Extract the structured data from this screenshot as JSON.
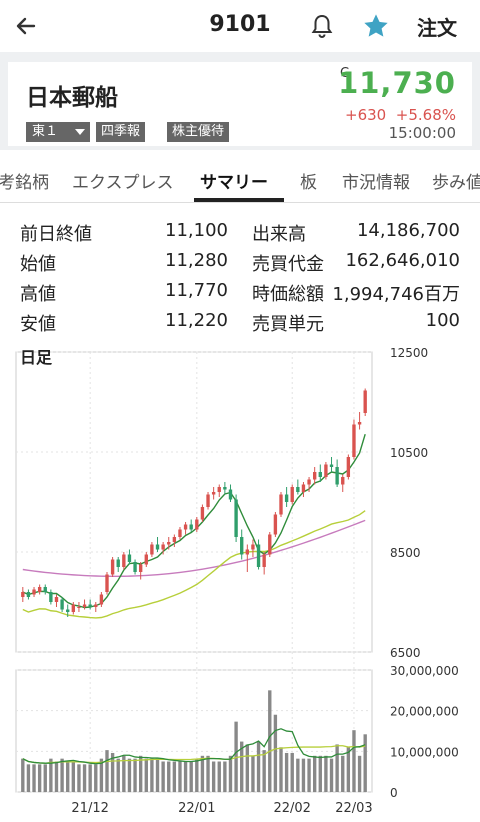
{
  "header": {
    "code": "9101",
    "order_label": "注文",
    "star_color": "#3fa3c4",
    "icons": [
      "back-arrow-icon",
      "bell-icon",
      "star-icon"
    ]
  },
  "stock": {
    "name": "日本郵船",
    "market": "東１",
    "tag_report": "四季報",
    "tag_yutai": "株主優待",
    "c_mark": "C",
    "price": "11,730",
    "change": "+630",
    "change_pct": "+5.68%",
    "time": "15:00:00",
    "price_color": "#4caf50",
    "change_color": "#d9534f"
  },
  "tabs": [
    "考銘柄",
    "エクスプレス",
    "サマリー",
    "板",
    "市況情報",
    "歩み値"
  ],
  "active_tab": "サマリー",
  "stats": {
    "prev_close_label": "前日終値",
    "prev_close": "11,100",
    "volume_label": "出来高",
    "volume": "14,186,700",
    "open_label": "始値",
    "open": "11,280",
    "trade_value_label": "売買代金",
    "trade_value": "162,646,010",
    "high_label": "高値",
    "high": "11,770",
    "market_cap_label": "時価総額",
    "market_cap": "1,994,746百万",
    "low_label": "安値",
    "low": "11,220",
    "unit_label": "売買単元",
    "unit": "100"
  },
  "chart_data": {
    "type": "candlestick",
    "title": "日足",
    "price_ticks": [
      "12500",
      "10500",
      "8500",
      "6500"
    ],
    "ylim": [
      6500,
      12500
    ],
    "volume_ticks": [
      "30,000,000",
      "20,000,000",
      "10,000,000",
      "0"
    ],
    "volume_ylim": [
      0,
      30000000
    ],
    "x_labels": [
      "21/12",
      "22/01",
      "22/02",
      "22/03"
    ],
    "candles_ohlc": [
      [
        7600,
        7800,
        7500,
        7700
      ],
      [
        7700,
        7750,
        7550,
        7600
      ],
      [
        7650,
        7800,
        7600,
        7750
      ],
      [
        7700,
        7850,
        7650,
        7800
      ],
      [
        7800,
        7850,
        7650,
        7700
      ],
      [
        7700,
        7750,
        7450,
        7500
      ],
      [
        7500,
        7650,
        7400,
        7600
      ],
      [
        7550,
        7600,
        7300,
        7350
      ],
      [
        7350,
        7450,
        7200,
        7300
      ],
      [
        7300,
        7500,
        7250,
        7450
      ],
      [
        7400,
        7500,
        7300,
        7400
      ],
      [
        7400,
        7550,
        7350,
        7450
      ],
      [
        7450,
        7550,
        7350,
        7400
      ],
      [
        7400,
        7500,
        7300,
        7450
      ],
      [
        7450,
        7700,
        7400,
        7650
      ],
      [
        7700,
        8100,
        7650,
        8050
      ],
      [
        8050,
        8400,
        8000,
        8350
      ],
      [
        8350,
        8400,
        8100,
        8200
      ],
      [
        8200,
        8500,
        8150,
        8450
      ],
      [
        8450,
        8550,
        8250,
        8300
      ],
      [
        8300,
        8350,
        8050,
        8100
      ],
      [
        8100,
        8300,
        7950,
        8250
      ],
      [
        8250,
        8500,
        8200,
        8450
      ],
      [
        8450,
        8700,
        8400,
        8650
      ],
      [
        8650,
        8800,
        8500,
        8550
      ],
      [
        8550,
        8700,
        8450,
        8650
      ],
      [
        8650,
        8800,
        8550,
        8700
      ],
      [
        8700,
        8850,
        8600,
        8800
      ],
      [
        8800,
        9000,
        8750,
        8950
      ],
      [
        8950,
        9100,
        8850,
        9050
      ],
      [
        9050,
        9150,
        8900,
        8950
      ],
      [
        8950,
        9200,
        8900,
        9150
      ],
      [
        9150,
        9450,
        9100,
        9400
      ],
      [
        9400,
        9700,
        9350,
        9650
      ],
      [
        9650,
        9800,
        9550,
        9700
      ],
      [
        9700,
        9850,
        9600,
        9800
      ],
      [
        9800,
        9900,
        9650,
        9750
      ],
      [
        9750,
        9850,
        9500,
        9550
      ],
      [
        9550,
        9650,
        8700,
        8800
      ],
      [
        8800,
        8950,
        8350,
        8450
      ],
      [
        8450,
        8650,
        8100,
        8550
      ],
      [
        8550,
        8750,
        8400,
        8650
      ],
      [
        8650,
        8750,
        8150,
        8200
      ],
      [
        8200,
        8500,
        8050,
        8450
      ],
      [
        8450,
        8900,
        8400,
        8850
      ],
      [
        8850,
        9300,
        8800,
        9250
      ],
      [
        9250,
        9700,
        9200,
        9650
      ],
      [
        9650,
        9800,
        9400,
        9500
      ],
      [
        9500,
        9850,
        9450,
        9800
      ],
      [
        9800,
        9950,
        9650,
        9700
      ],
      [
        9700,
        9900,
        9600,
        9850
      ],
      [
        9850,
        10000,
        9700,
        9950
      ],
      [
        9950,
        10200,
        9850,
        10100
      ],
      [
        10100,
        10250,
        9900,
        10000
      ],
      [
        10000,
        10300,
        9950,
        10250
      ],
      [
        10250,
        10400,
        10100,
        10200
      ],
      [
        10200,
        10350,
        9800,
        9850
      ],
      [
        9850,
        10050,
        9700,
        10000
      ],
      [
        10000,
        10450,
        9950,
        10400
      ],
      [
        10400,
        11150,
        10350,
        11050
      ],
      [
        11050,
        11300,
        10950,
        11100
      ],
      [
        11280,
        11770,
        11220,
        11730
      ]
    ],
    "ma_short_endpoints": [
      7700,
      11100
    ],
    "ma_mid_endpoints": [
      7700,
      9750
    ],
    "ma_long_endpoints": [
      8150,
      9150
    ],
    "volume_note": "daily volume bars, latest ~14,186,700",
    "colors": {
      "up": "#d9534f",
      "down": "#2f9e6b",
      "ma_short": "#2f8c3a",
      "ma_mid": "#b7cf3a",
      "ma_long": "#c77bbd",
      "vol": "#888888"
    }
  }
}
